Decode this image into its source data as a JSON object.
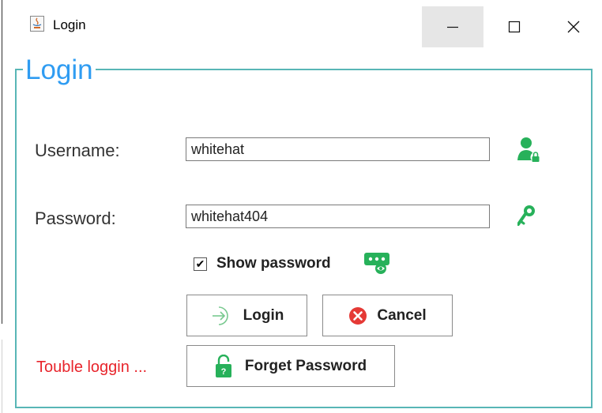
{
  "window": {
    "title": "Login",
    "app_icon": "java-cup-icon",
    "controls": [
      "minimize-icon",
      "maximize-icon",
      "close-icon"
    ]
  },
  "form": {
    "group_title": "Login",
    "username_label": "Username:",
    "username_value": "whitehat",
    "username_icon": "user-lock-icon",
    "password_label": "Password:",
    "password_value": "whitehat404",
    "password_icon": "key-icon",
    "show_password_label": "Show password",
    "show_password_checked": true,
    "show_password_icon": "eye-toggle-icon"
  },
  "buttons": {
    "login_label": "Login",
    "login_icon": "enter-icon",
    "cancel_label": "Cancel",
    "cancel_icon": "cancel-x-icon",
    "forget_label": "Forget Password",
    "forget_icon": "padlock-icon"
  },
  "links": {
    "trouble_text": "Touble loggin ..."
  },
  "colors": {
    "title_blue": "#2f9cf2",
    "border_teal": "#58b6b6",
    "icon_green": "#27b15a",
    "cancel_red": "#e53935",
    "trouble_red": "#e8252c"
  }
}
